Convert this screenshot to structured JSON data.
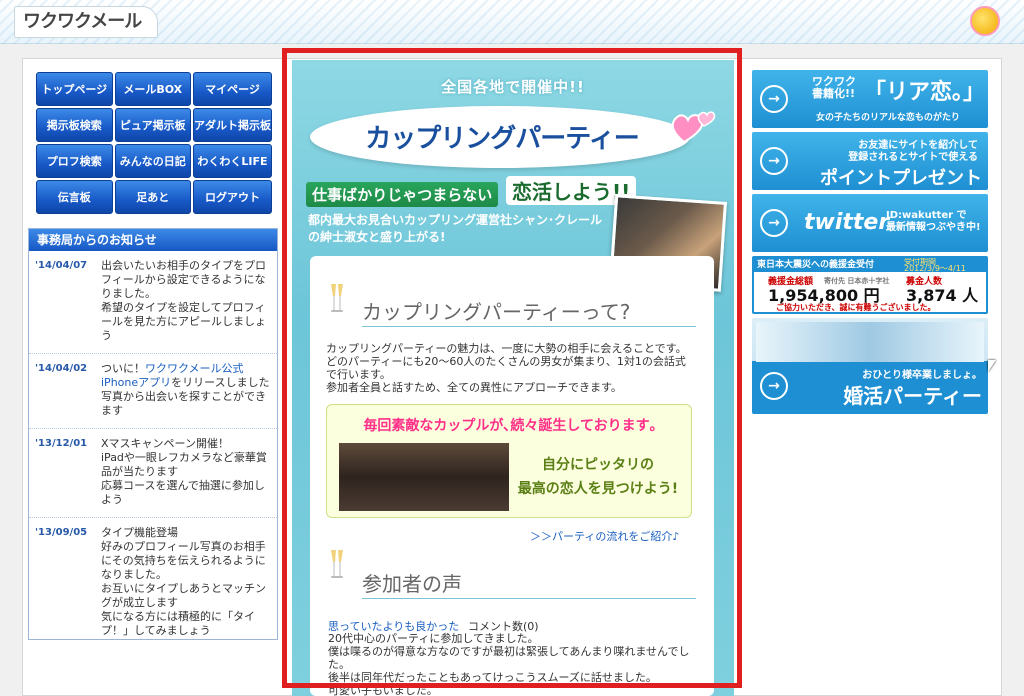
{
  "header": {
    "logo_text": "ワクワクメール"
  },
  "nav": {
    "items": [
      "トップページ",
      "メールBOX",
      "マイページ",
      "掲示板検索",
      "ピュア掲示板",
      "アダルト掲示板",
      "プロフ検索",
      "みんなの日記",
      "わくわくLIFE",
      "伝言板",
      "足あと",
      "ログアウト"
    ]
  },
  "news": {
    "title": "事務局からのお知らせ",
    "items": [
      {
        "date": "'14/04/07",
        "text": "出会いたいお相手のタイプをプロフィールから設定できるようになりました。\n希望のタイプを設定してプロフィールを見た方にアピールしましょう"
      },
      {
        "date": "'14/04/02",
        "pre": "ついに！",
        "link": "ワクワクメール公式iPhoneアプリ",
        "text": "をリリースしました\n写真から出会いを探すことができます"
      },
      {
        "date": "'13/12/01",
        "text": "Xマスキャンペーン開催！\niPadや一眼レフカメラなど豪華賞品が当たります\n応募コースを選んで抽選に参加しよう"
      },
      {
        "date": "'13/09/05",
        "text": "タイプ機能登場\n好みのプロフィール写真のお相手にその気持ちを伝えられるようになりました。\nお互いにタイプしあうとマッチングが成立します\n気になる方には積極的に「タイプ！」してみましょう"
      }
    ]
  },
  "center": {
    "subtitle": "全国各地で開催中!!",
    "title": "カップリングパーティー",
    "tag1": "仕事ばかりじゃつまらない",
    "tag2": "恋活しよう!!",
    "desc": "都内最大お見合いカップリング運営社シャン･クレールの紳士淑女と盛り上がる!",
    "section1_title": "カップリングパーティーって?",
    "section1_text": "カップリングパーティーの魅力は、一度に大勢の相手に会えることです。どのパーティーにも20～60人のたくさんの男女が集まり、1対1の会話式で行います。\n参加者全員と話すため、全ての異性にアプローチできます。",
    "green_title": "毎回素敵なカップルが､続々誕生しております｡",
    "green_text": "自分にピッタリの\n最高の恋人を見つけよう!",
    "flow_link": "＞＞パーティの流れをご紹介♪",
    "section2_title": "参加者の声",
    "voice_link": "思っていたよりも良かった",
    "voice_count": "コメント数(0)",
    "voice_text": "20代中心のパーティに参加してきました。\n僕は喋るのが得意な方なのですが最初は緊張してあんまり喋れませんでした。\n後半は同年代だったこともあってけっこうスムーズに話せました。\n可愛い子もいました。"
  },
  "right": {
    "b1_line1": "ワクワク\n書籍化!!",
    "b1_line2": "「リア恋｡」",
    "b1_line3": "女の子たちのリアルな恋ものがたり",
    "b2_line1": "お友達にサイトを紹介して\n登録されるとサイトで使える",
    "b2_line2": "ポイントプレゼント",
    "b3_logo": "twitter",
    "b3_text": "ID:wakutter で\n最新情報つぶやき中!",
    "b4_top": "東日本大震災への義援金受付",
    "b4_period": "受付期間\n2012/3/9～4/11",
    "b4_label1": "義援金総額",
    "b4_label1_sub": "寄付先 日本赤十字社",
    "b4_amount": "1,954,800 円",
    "b4_label2": "募金人数",
    "b4_count": "3,874 人",
    "b4_note": "ご協力いただき、誠に有難うございました。",
    "b5_line1": "おひとり様卒業しましょ。",
    "b5_line2": "婚活パーティー"
  }
}
